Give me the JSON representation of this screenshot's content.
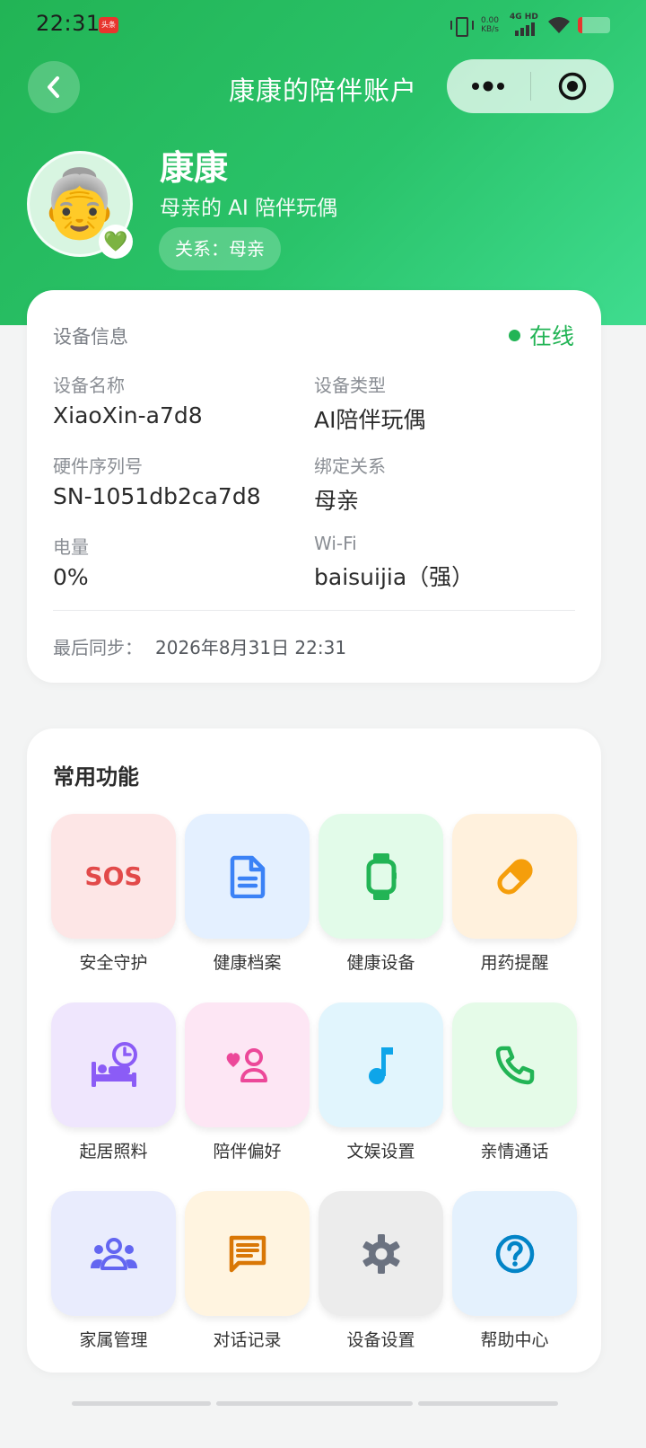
{
  "status_bar": {
    "time": "22:31",
    "badge": "头条",
    "net_speed_top": "0.00",
    "net_speed_unit": "KB/s",
    "net_type": "4G HD"
  },
  "nav": {
    "title": "康康的陪伴账户"
  },
  "profile": {
    "name": "康康",
    "subtitle": "母亲的 AI 陪伴玩偶",
    "relation": "关系：母亲",
    "avatar_emoji": "👵",
    "heart_emoji": "💚"
  },
  "device": {
    "section_title": "设备信息",
    "status": "在线",
    "fields": [
      {
        "label": "设备名称",
        "value": "XiaoXin-a7d8"
      },
      {
        "label": "设备类型",
        "value": "AI陪伴玩偶"
      },
      {
        "label": "硬件序列号",
        "value": "SN-1051db2ca7d8"
      },
      {
        "label": "绑定关系",
        "value": "母亲"
      },
      {
        "label": "电量",
        "value": "0%"
      },
      {
        "label": "Wi-Fi",
        "value": "baisuijia（强）"
      }
    ],
    "last_sync_label": "最后同步：",
    "last_sync_value": "2026年8月31日 22:31"
  },
  "functions": {
    "title": "常用功能",
    "items": [
      {
        "label": "安全守护",
        "icon": "sos-icon",
        "icon_text": "SOS",
        "bg": "#fde6e6",
        "color": "#e24a4a"
      },
      {
        "label": "健康档案",
        "icon": "document-icon",
        "bg": "#e4f0ff",
        "color": "#3b82f6"
      },
      {
        "label": "健康设备",
        "icon": "smartwatch-icon",
        "bg": "#e2fbe9",
        "color": "#22b455"
      },
      {
        "label": "用药提醒",
        "icon": "pill-icon",
        "bg": "#fff1dd",
        "color": "#f59e0b"
      },
      {
        "label": "起居照料",
        "icon": "bed-clock-icon",
        "bg": "#efe6fd",
        "color": "#8b5cf6"
      },
      {
        "label": "陪伴偏好",
        "icon": "heart-person-icon",
        "bg": "#fde6f4",
        "color": "#ec4899"
      },
      {
        "label": "文娱设置",
        "icon": "music-note-icon",
        "bg": "#e1f5fd",
        "color": "#0ea5e9"
      },
      {
        "label": "亲情通话",
        "icon": "phone-icon",
        "bg": "#e5fbe8",
        "color": "#22b455"
      },
      {
        "label": "家属管理",
        "icon": "family-group-icon",
        "bg": "#e9ecfd",
        "color": "#6366f1"
      },
      {
        "label": "对话记录",
        "icon": "chat-icon",
        "bg": "#fff4e0",
        "color": "#d97706"
      },
      {
        "label": "设备设置",
        "icon": "gear-icon",
        "bg": "#ececec",
        "color": "#6b7280"
      },
      {
        "label": "帮助中心",
        "icon": "help-icon",
        "bg": "#e4f1fd",
        "color": "#0284c7"
      }
    ]
  }
}
